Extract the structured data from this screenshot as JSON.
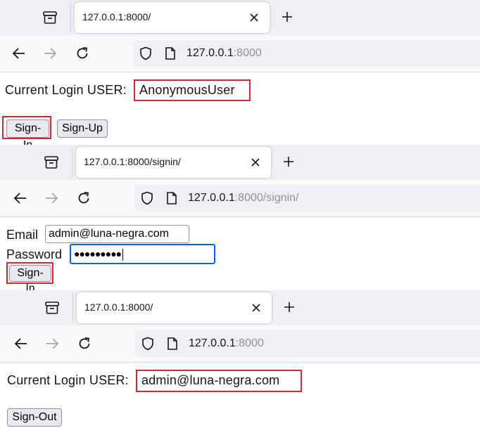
{
  "frames": [
    {
      "tab_title": "127.0.0.1:8000/",
      "url_host": "127.0.0.1",
      "url_path": ":8000",
      "user_label": "Current Login USER: ",
      "user_value": "AnonymousUser",
      "sign_in_label": "Sign-In",
      "sign_up_label": "Sign-Up"
    },
    {
      "tab_title": "127.0.0.1:8000/signin/",
      "url_host": "127.0.0.1",
      "url_path": ":8000/signin/",
      "email_label": "Email",
      "email_value": "admin@luna-negra.com",
      "password_label": "Password",
      "password_value": "●●●●●●●●●",
      "sign_in_label": "Sign-In"
    },
    {
      "tab_title": "127.0.0.1:8000/",
      "url_host": "127.0.0.1",
      "url_path": ":8000",
      "user_label": "Current Login USER: ",
      "user_value": "admin@luna-negra.com",
      "sign_out_label": "Sign-Out"
    }
  ],
  "icons": {
    "tab_list": "tab-list-icon",
    "close": "close-icon",
    "new_tab": "plus-icon",
    "back": "back-arrow-icon",
    "forward": "forward-arrow-icon",
    "reload": "reload-icon",
    "shield": "shield-icon",
    "page": "page-icon"
  },
  "colors": {
    "highlight": "#d7262f",
    "focus": "#0060df"
  }
}
